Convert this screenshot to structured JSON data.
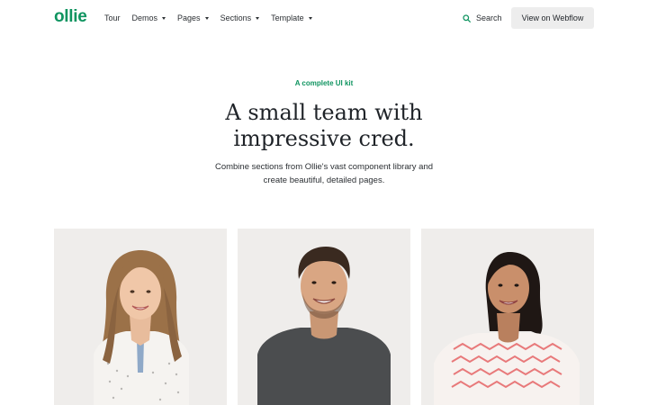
{
  "nav": {
    "logo": "ollie",
    "items": [
      {
        "label": "Tour"
      },
      {
        "label": "Demos"
      },
      {
        "label": "Pages"
      },
      {
        "label": "Sections"
      },
      {
        "label": "Template"
      }
    ],
    "search_label": "Search",
    "cta_label": "View on Webflow"
  },
  "hero": {
    "eyebrow": "A complete UI kit",
    "headline_line1": "A small team with",
    "headline_line2": "impressive cred.",
    "subtext_line1": "Combine sections from Ollie's vast component library and",
    "subtext_line2": "create beautiful, detailed pages."
  },
  "colors": {
    "brand": "#0f9460",
    "card_bg": "#efedeb",
    "button_bg": "#ededed"
  },
  "icons": {
    "search": "search-icon",
    "dropdown": "chevron-down-icon"
  }
}
